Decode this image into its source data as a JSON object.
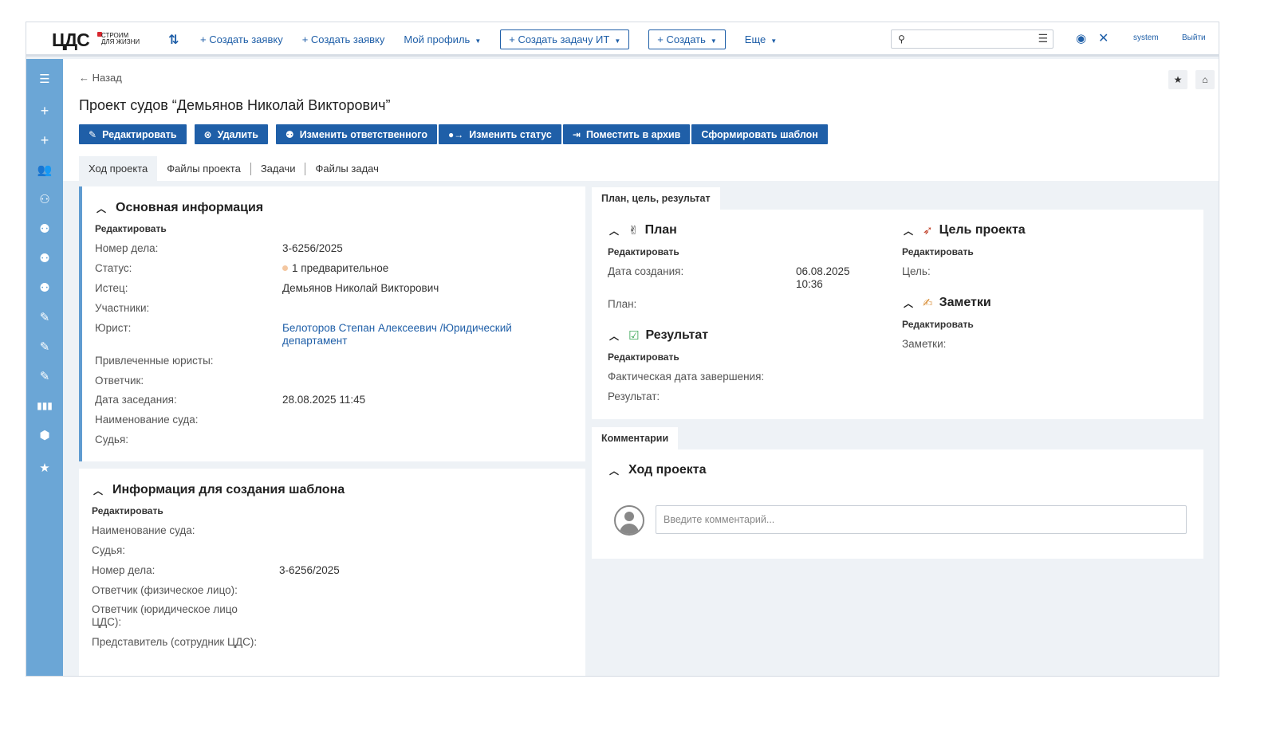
{
  "header": {
    "logo_main": "ЦДС",
    "logo_sub_1": "СТРОИМ",
    "logo_sub_2": "ДЛЯ ЖИЗНИ",
    "nav": [
      {
        "label": "+ Создать заявку"
      },
      {
        "label": "+ Создать заявку"
      },
      {
        "label": "Мой профиль"
      }
    ],
    "btn_create_task": "+  Создать задачу ИТ",
    "btn_create": "+  Создать",
    "more": "Еще",
    "user": "system",
    "logout": "Выйти"
  },
  "page": {
    "back": "← Назад",
    "title": "Проект судов “Демьянов Николай Викторович”",
    "actions": {
      "edit": "Редактировать",
      "delete": "Удалить",
      "change_responsible": "Изменить ответственного",
      "change_status": "Изменить статус",
      "archive": "Поместить в архив",
      "template": "Сформировать шаблон"
    },
    "tabs": [
      "Ход проекта",
      "Файлы проекта",
      "Задачи",
      "Файлы задач"
    ]
  },
  "main_info": {
    "title": "Основная информация",
    "edit": "Редактировать",
    "fields": [
      {
        "label": "Номер дела:",
        "value": "3-6256/2025"
      },
      {
        "label": "Статус:",
        "value": "1 предварительное"
      },
      {
        "label": "Истец:",
        "value": "Демьянов Николай Викторович"
      },
      {
        "label": "Участники:",
        "value": ""
      },
      {
        "label": "Юрист:",
        "value": "Белоторов Степан Алексеевич /Юридический департамент"
      },
      {
        "label": "Привлеченные юристы:",
        "value": ""
      },
      {
        "label": "Ответчик:",
        "value": ""
      },
      {
        "label": "Дата заседания:",
        "value": "28.08.2025 11:45"
      },
      {
        "label": "Наименование суда:",
        "value": ""
      },
      {
        "label": "Судья:",
        "value": ""
      }
    ],
    "lawyer_line1": "Белоторов Степан Алексеевич /Юридический",
    "lawyer_line2": "департамент"
  },
  "template_info": {
    "title": "Информация для создания шаблона",
    "edit": "Редактировать",
    "fields": [
      {
        "label": "Наименование суда:",
        "value": ""
      },
      {
        "label": "Судья:",
        "value": ""
      },
      {
        "label": "Номер дела:",
        "value": "3-6256/2025"
      },
      {
        "label": "Ответчик (физическое лицо):",
        "value": ""
      },
      {
        "label": "Ответчик (юридическое лицо ЦДС):",
        "value": ""
      },
      {
        "label": "Представитель (сотрудник ЦДС):",
        "value": ""
      }
    ],
    "defendant_legal_1": "Ответчик (юридическое лицо",
    "defendant_legal_2": "ЦДС):"
  },
  "plan_panel": {
    "tab": "План, цель, результат",
    "plan": {
      "title": "План",
      "edit": "Редактировать",
      "created_label": "Дата создания:",
      "created_date": "06.08.2025",
      "created_time": "10:36",
      "plan_label": "План:"
    },
    "result": {
      "title": "Результат",
      "edit": "Редактировать",
      "actual_label": "Фактическая дата завершения:",
      "result_label": "Результат:"
    },
    "goal": {
      "title": "Цель проекта",
      "edit": "Редактировать",
      "goal_label": "Цель:"
    },
    "notes": {
      "title": "Заметки",
      "edit": "Редактировать",
      "notes_label": "Заметки:"
    }
  },
  "comments": {
    "tab": "Комментарии",
    "title": "Ход проекта",
    "placeholder": "Введите комментарий..."
  },
  "colors": {
    "accent": "#1f5fa8",
    "sidebar": "#6ba6d6",
    "background": "#eef2f6"
  }
}
